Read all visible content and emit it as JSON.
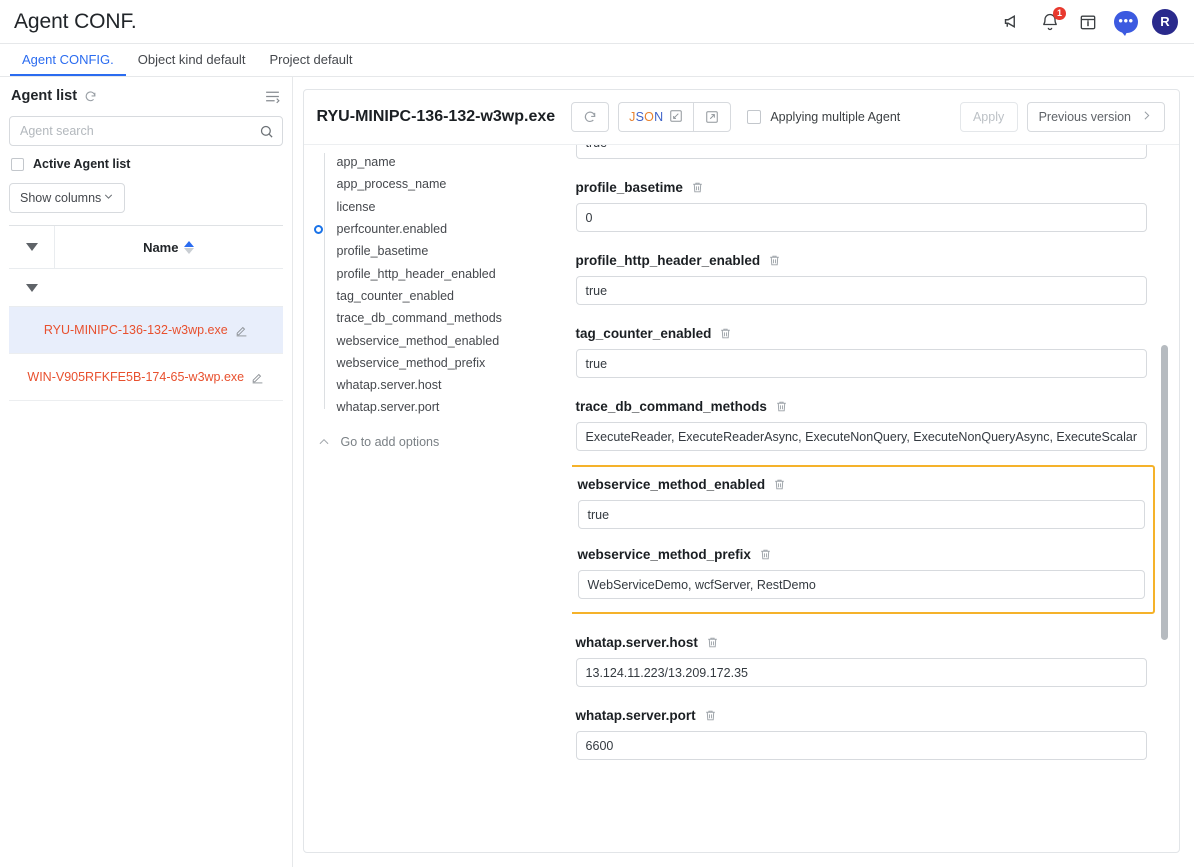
{
  "header": {
    "app_title": "Agent CONF.",
    "icons": [
      {
        "name": "megaphone-icon"
      },
      {
        "name": "bell-icon",
        "badge": "1"
      },
      {
        "name": "calendar-info-icon"
      },
      {
        "name": "chat-icon"
      },
      {
        "name": "avatar",
        "initial": "R"
      }
    ]
  },
  "tabs": [
    {
      "label": "Agent CONFIG.",
      "active": true
    },
    {
      "label": "Object kind default",
      "active": false
    },
    {
      "label": "Project default",
      "active": false
    }
  ],
  "sidebar": {
    "title": "Agent list",
    "refresh_icon": "refresh-icon",
    "columns_icon": "columns-toggle-icon",
    "search": {
      "value": "",
      "placeholder": "Agent search"
    },
    "active_agent_checkbox": {
      "label": "Active Agent list",
      "checked": false
    },
    "show_columns": {
      "label": "Show columns"
    },
    "table": {
      "column_header": "Name",
      "rows": [
        {
          "name": "RYU-MINIPC-136-132-w3wp.exe",
          "selected": true
        },
        {
          "name": "WIN-V905RFKFE5B-174-65-w3wp.exe",
          "selected": false
        }
      ]
    }
  },
  "panel": {
    "title": "RYU-MINIPC-136-132-w3wp.exe",
    "refresh_button": "refresh-icon",
    "json_button": "JSON",
    "export_button": "external-link-icon",
    "multi_agent_checkbox": {
      "label": "Applying multiple Agent",
      "checked": false
    },
    "apply_button": "Apply",
    "previous_version_button": "Previous version",
    "tree": {
      "items": [
        {
          "label": "app_name",
          "marked": false
        },
        {
          "label": "app_process_name",
          "marked": false
        },
        {
          "label": "license",
          "marked": false
        },
        {
          "label": "perfcounter.enabled",
          "marked": true
        },
        {
          "label": "profile_basetime",
          "marked": false
        },
        {
          "label": "profile_http_header_enabled",
          "marked": false
        },
        {
          "label": "tag_counter_enabled",
          "marked": false
        },
        {
          "label": "trace_db_command_methods",
          "marked": false
        },
        {
          "label": "webservice_method_enabled",
          "marked": false
        },
        {
          "label": "webservice_method_prefix",
          "marked": false
        },
        {
          "label": "whatap.server.host",
          "marked": false
        },
        {
          "label": "whatap.server.port",
          "marked": false
        }
      ],
      "add_options": "Go to add options"
    },
    "partial_field_value": "true",
    "fields": [
      {
        "label": "profile_basetime",
        "value": "0"
      },
      {
        "label": "profile_http_header_enabled",
        "value": "true"
      },
      {
        "label": "tag_counter_enabled",
        "value": "true"
      },
      {
        "label": "trace_db_command_methods",
        "value": "ExecuteReader, ExecuteReaderAsync, ExecuteNonQuery, ExecuteNonQueryAsync, ExecuteScalar"
      }
    ],
    "highlighted_fields": [
      {
        "label": "webservice_method_enabled",
        "value": "true"
      },
      {
        "label": "webservice_method_prefix",
        "value": "WebServiceDemo, wcfServer, RestDemo"
      }
    ],
    "fields_after": [
      {
        "label": "whatap.server.host",
        "value": "13.124.11.223/13.209.172.35"
      },
      {
        "label": "whatap.server.port",
        "value": "6600"
      }
    ],
    "highlight_color": "#f5b22a"
  }
}
